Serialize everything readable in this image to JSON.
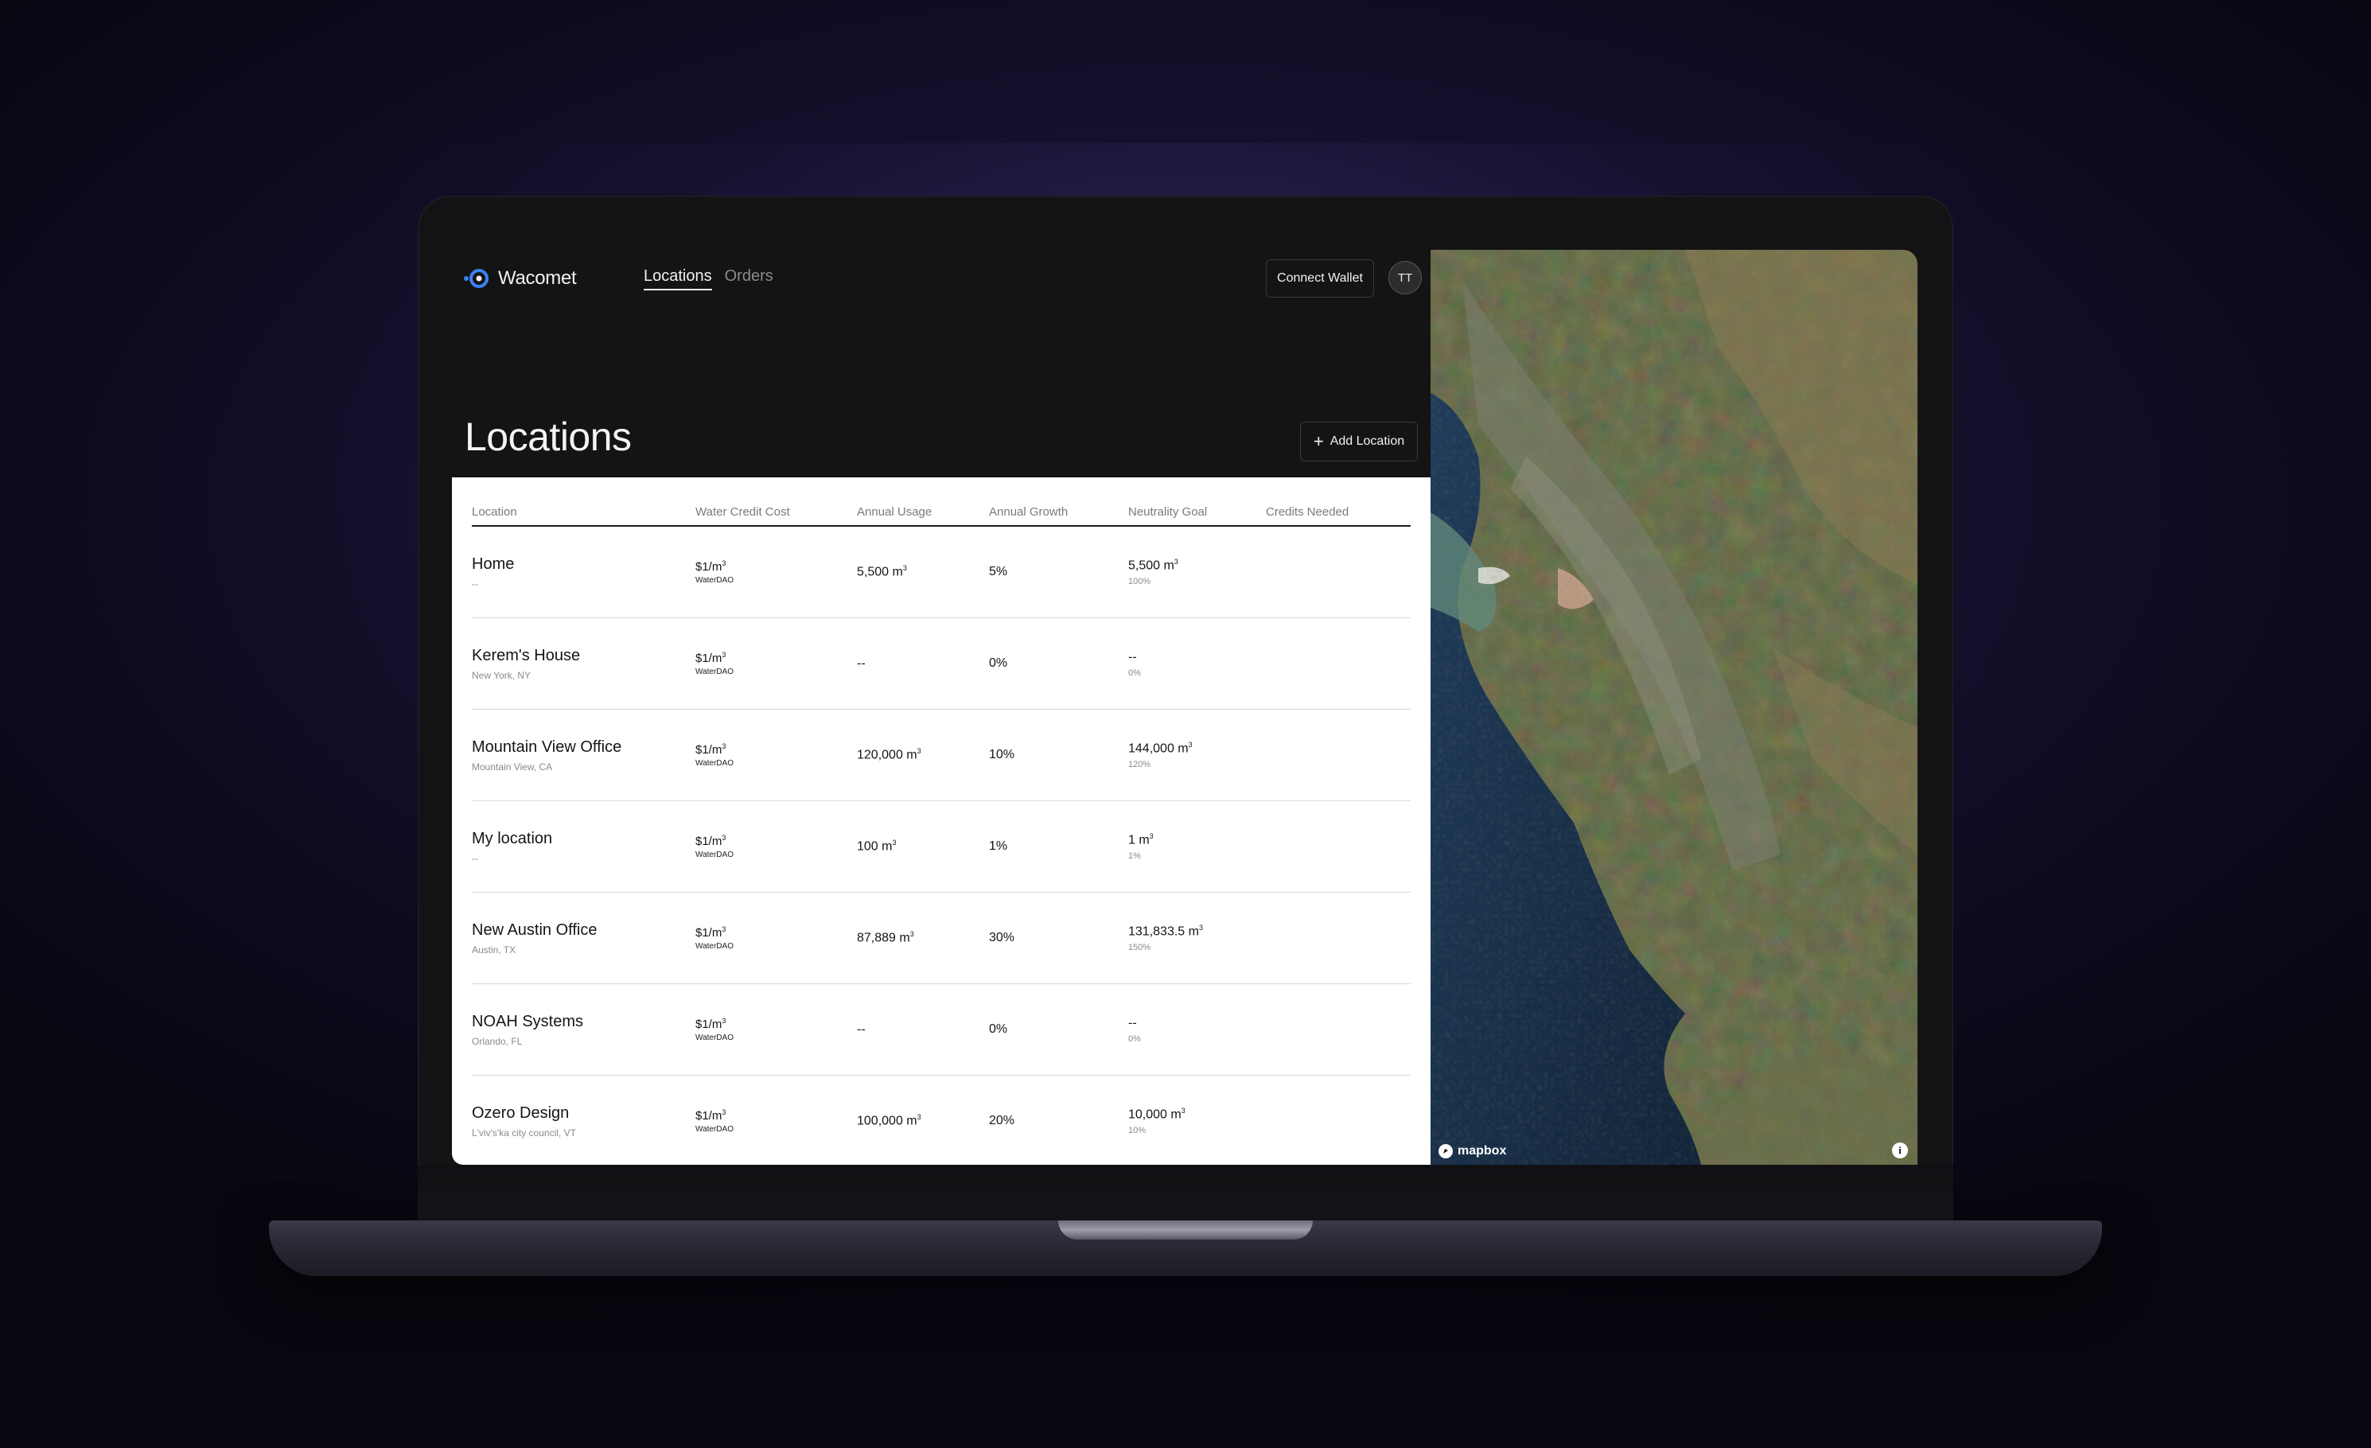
{
  "app": {
    "brand": "Wacomet",
    "nav": [
      {
        "label": "Locations",
        "active": true
      },
      {
        "label": "Orders",
        "active": false
      }
    ],
    "connect_wallet": "Connect Wallet",
    "avatar_initials": "TT",
    "page_title": "Locations",
    "add_location": "Add Location",
    "accent_color": "#3b82f6"
  },
  "table": {
    "headers": {
      "location": "Location",
      "cost": "Water Credit Cost",
      "usage": "Annual Usage",
      "growth": "Annual Growth",
      "goal": "Neutrality Goal",
      "credits": "Credits Needed"
    },
    "rows": [
      {
        "name": "Home",
        "sub": "--",
        "cost": "$1/m",
        "cost_sup": "3",
        "cost_provider": "WaterDAO",
        "usage": "5,500 m",
        "usage_sup": "3",
        "growth": "5%",
        "goal": "5,500 m",
        "goal_sup": "3",
        "goal_pct": "100%",
        "credits": ""
      },
      {
        "name": "Kerem's House",
        "sub": "New York, NY",
        "cost": "$1/m",
        "cost_sup": "3",
        "cost_provider": "WaterDAO",
        "usage": "--",
        "usage_sup": "",
        "growth": "0%",
        "goal": "--",
        "goal_sup": "",
        "goal_pct": "0%",
        "credits": ""
      },
      {
        "name": "Mountain View Office",
        "sub": "Mountain View, CA",
        "cost": "$1/m",
        "cost_sup": "3",
        "cost_provider": "WaterDAO",
        "usage": "120,000 m",
        "usage_sup": "3",
        "growth": "10%",
        "goal": "144,000 m",
        "goal_sup": "3",
        "goal_pct": "120%",
        "credits": ""
      },
      {
        "name": "My location",
        "sub": "--",
        "cost": "$1/m",
        "cost_sup": "3",
        "cost_provider": "WaterDAO",
        "usage": "100 m",
        "usage_sup": "3",
        "growth": "1%",
        "goal": "1 m",
        "goal_sup": "3",
        "goal_pct": "1%",
        "credits": ""
      },
      {
        "name": "New Austin Office",
        "sub": "Austin, TX",
        "cost": "$1/m",
        "cost_sup": "3",
        "cost_provider": "WaterDAO",
        "usage": "87,889 m",
        "usage_sup": "3",
        "growth": "30%",
        "goal": "131,833.5 m",
        "goal_sup": "3",
        "goal_pct": "150%",
        "credits": ""
      },
      {
        "name": "NOAH Systems",
        "sub": "Orlando, FL",
        "cost": "$1/m",
        "cost_sup": "3",
        "cost_provider": "WaterDAO",
        "usage": "--",
        "usage_sup": "",
        "growth": "0%",
        "goal": "--",
        "goal_sup": "",
        "goal_pct": "0%",
        "credits": ""
      },
      {
        "name": "Ozero Design",
        "sub": "L'viv's'ka city council, VT",
        "cost": "$1/m",
        "cost_sup": "3",
        "cost_provider": "WaterDAO",
        "usage": "100,000 m",
        "usage_sup": "3",
        "growth": "20%",
        "goal": "10,000 m",
        "goal_sup": "3",
        "goal_pct": "10%",
        "credits": ""
      }
    ]
  },
  "map": {
    "attribution": "mapbox",
    "info_icon": "info-icon"
  }
}
